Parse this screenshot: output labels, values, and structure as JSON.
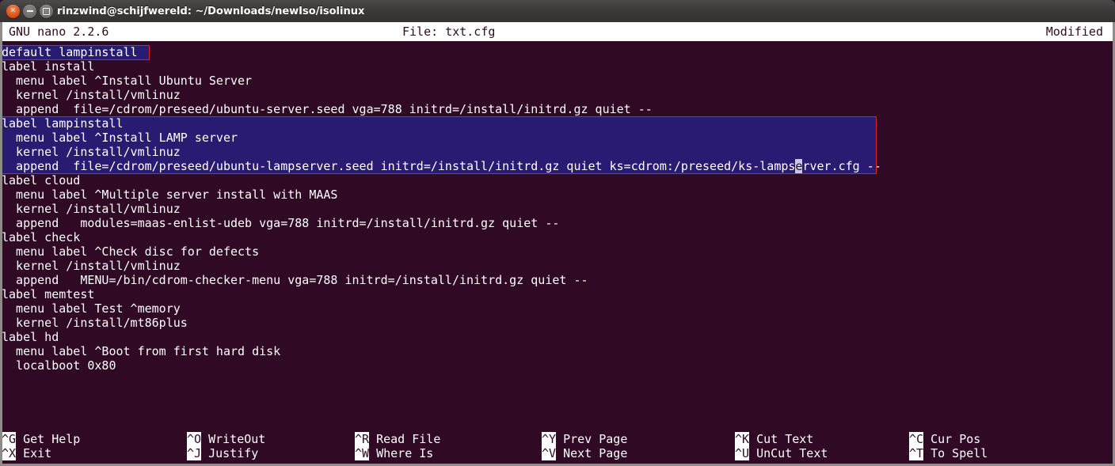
{
  "window": {
    "title": "rinzwind@schijfwereld: ~/Downloads/newIso/isolinux",
    "buttons": {
      "close": "×",
      "minimize": "−",
      "maximize": "□"
    },
    "colors": {
      "titlebar": "#3b3937",
      "close": "#dd4814",
      "terminal_bg": "#300a24",
      "selection_bg": "#2a1b72",
      "highlight_border": "#e02020",
      "cursor": "#c8c8e8"
    }
  },
  "nano_header": {
    "version": "GNU nano 2.2.6",
    "file_label": "File: txt.cfg",
    "status": "Modified"
  },
  "editor": {
    "lines": [
      "default lampinstall",
      "label install",
      "  menu label ^Install Ubuntu Server",
      "  kernel /install/vmlinuz",
      "  append  file=/cdrom/preseed/ubuntu-server.seed vga=788 initrd=/install/initrd.gz quiet --",
      "label lampinstall",
      "  menu label ^Install LAMP server",
      "  kernel /install/vmlinuz",
      "  append  file=/cdrom/preseed/ubuntu-lampserver.seed initrd=/install/initrd.gz quiet ks=cdrom:/preseed/ks-lampserver.cfg --",
      "label cloud",
      "  menu label ^Multiple server install with MAAS",
      "  kernel /install/vmlinuz",
      "  append   modules=maas-enlist-udeb vga=788 initrd=/install/initrd.gz quiet --",
      "label check",
      "  menu label ^Check disc for defects",
      "  kernel /install/vmlinuz",
      "  append   MENU=/bin/cdrom-checker-menu vga=788 initrd=/install/initrd.gz quiet --",
      "label memtest",
      "  menu label Test ^memory",
      "  kernel /install/mt86plus",
      "label hd",
      "  menu label ^Boot from first hard disk",
      "  localboot 0x80"
    ],
    "highlighted_line_indexes": [
      0,
      5,
      6,
      7,
      8
    ],
    "cursor": {
      "line_index": 8,
      "column": 111,
      "character": "."
    }
  },
  "footer": {
    "row1": [
      {
        "key": "^G",
        "label": "Get Help"
      },
      {
        "key": "^O",
        "label": "WriteOut"
      },
      {
        "key": "^R",
        "label": "Read File"
      },
      {
        "key": "^Y",
        "label": "Prev Page"
      },
      {
        "key": "^K",
        "label": "Cut Text"
      },
      {
        "key": "^C",
        "label": "Cur Pos"
      }
    ],
    "row2": [
      {
        "key": "^X",
        "label": "Exit"
      },
      {
        "key": "^J",
        "label": "Justify"
      },
      {
        "key": "^W",
        "label": "Where Is"
      },
      {
        "key": "^V",
        "label": "Next Page"
      },
      {
        "key": "^U",
        "label": "UnCut Text"
      },
      {
        "key": "^T",
        "label": "To Spell"
      }
    ]
  }
}
